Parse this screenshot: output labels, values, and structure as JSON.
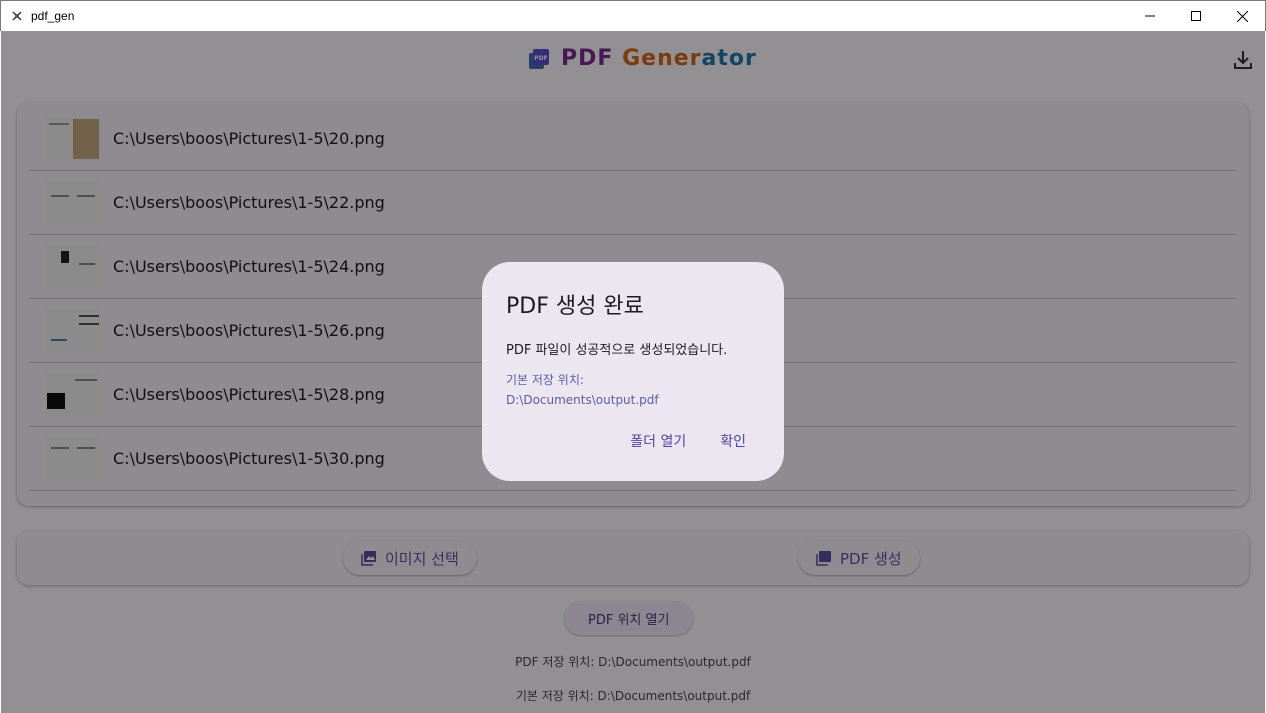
{
  "window": {
    "title": "pdf_gen"
  },
  "header": {
    "title_part1": "PDF",
    "title_part2": "Gener",
    "title_part3": "ator",
    "logo_label": "PDF"
  },
  "images": [
    {
      "path": "C:\\Users\\boos\\Pictures\\1-5\\20.png"
    },
    {
      "path": "C:\\Users\\boos\\Pictures\\1-5\\22.png"
    },
    {
      "path": "C:\\Users\\boos\\Pictures\\1-5\\24.png"
    },
    {
      "path": "C:\\Users\\boos\\Pictures\\1-5\\26.png"
    },
    {
      "path": "C:\\Users\\boos\\Pictures\\1-5\\28.png"
    },
    {
      "path": "C:\\Users\\boos\\Pictures\\1-5\\30.png"
    }
  ],
  "actions": {
    "select_images": "이미지 선택",
    "generate_pdf": "PDF 생성",
    "open_location": "PDF 위치 열기"
  },
  "info": {
    "pdf_location": "PDF 저장 위치: D:\\Documents\\output.pdf",
    "default_location": "기본 저장 위치: D:\\Documents\\output.pdf"
  },
  "dialog": {
    "title": "PDF 생성 완료",
    "message": "PDF 파일이 성공적으로 생성되었습니다.",
    "path_label": "기본 저장 위치:",
    "path_value": "D:\\Documents\\output.pdf",
    "open_folder": "폴더 열기",
    "confirm": "확인"
  },
  "colors": {
    "accent": "#6750a4",
    "title_purple": "#7b2c8f",
    "title_orange": "#d2661a",
    "title_blue": "#2479a8"
  }
}
